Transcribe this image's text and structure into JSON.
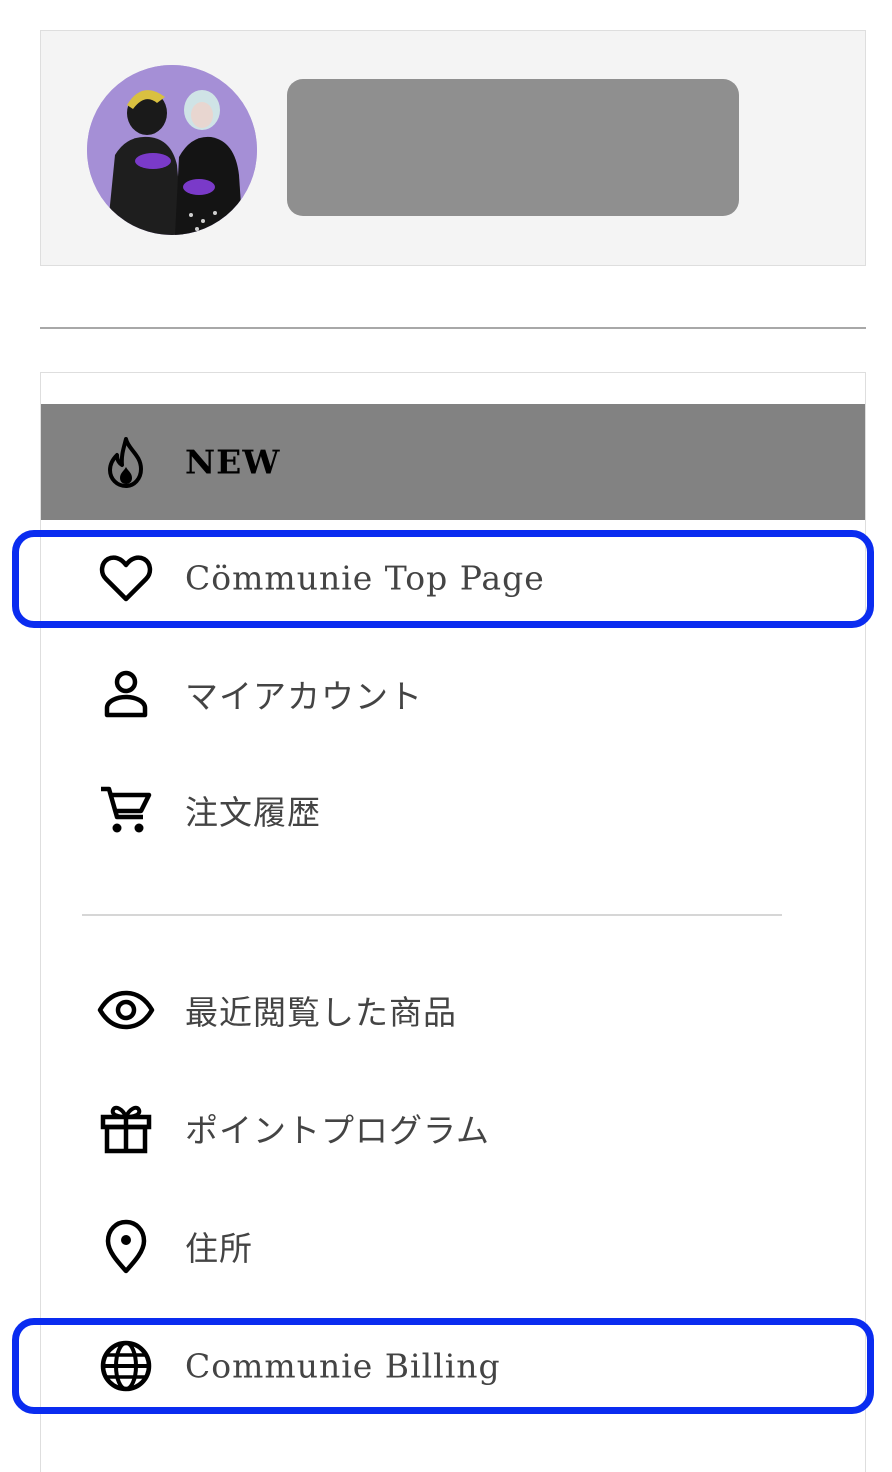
{
  "profile": {
    "avatar": "group-avatar-photo",
    "name_redacted": true
  },
  "menu": {
    "items": [
      {
        "label": "NEW",
        "icon": "flame-icon",
        "active": true
      },
      {
        "label": "Cömmunie Top Page",
        "icon": "heart-icon",
        "active": false
      },
      {
        "label": "マイアカウント",
        "icon": "person-icon",
        "active": false
      },
      {
        "label": "注文履歴",
        "icon": "cart-icon",
        "active": false
      },
      {
        "label": "最近閲覧した商品",
        "icon": "eye-icon",
        "active": false
      },
      {
        "label": "ポイントプログラム",
        "icon": "gift-icon",
        "active": false
      },
      {
        "label": "住所",
        "icon": "location-pin-icon",
        "active": false
      },
      {
        "label": "Communie Billing",
        "icon": "globe-icon",
        "active": false
      }
    ]
  },
  "annotations": {
    "highlight_color": "#0a2cf0",
    "highlighted_items": [
      "Cömmunie Top Page",
      "Communie Billing"
    ]
  },
  "colors": {
    "active_row": "#828282",
    "profile_bg": "#f4f4f4",
    "label_text": "#444444"
  }
}
